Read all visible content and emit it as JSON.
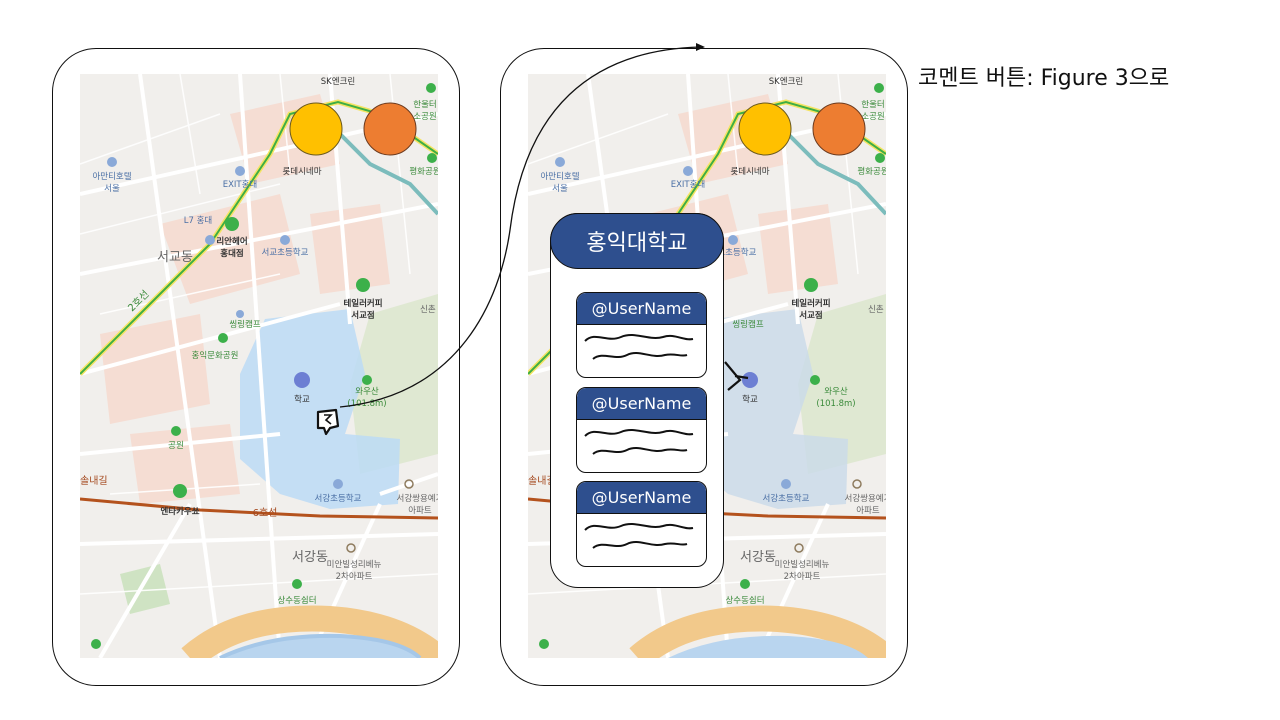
{
  "annotation": {
    "note": "코멘트 버튼: Figure 3으로"
  },
  "colors": {
    "yellow_button": "#FFC000",
    "orange_button": "#ED7D31",
    "popup_blue": "#2E4F8E"
  },
  "map": {
    "labels": {
      "sk": "SK엔크린",
      "amanti": "아만티호텔",
      "seoul": "서울",
      "exit": "EXIT홍대",
      "lotte": "롯데시네마",
      "l7": "L7 홍대",
      "lian1": "리안헤어",
      "lian2": "홍대점",
      "school": "서교초등학교",
      "seogyo": "서교동",
      "line2": "2호선",
      "tailor1": "테일러커피",
      "tailor2": "서교점",
      "ssiring": "씽링캠프",
      "hongik_park": "홍익문화공원",
      "campus": "학교",
      "wausan1": "와우산",
      "wausan2": "(101.8m)",
      "sinchon": "신촌",
      "park": "공원",
      "road": "솔내길",
      "entakarusu": "엔타카우쑈",
      "line6": "6호선",
      "seogang_school": "서강초등학교",
      "ssangyong1": "서강쌍용예가",
      "ssangyong2": "아파트",
      "seogangdong": "서강동",
      "miyan1": "미안빌성리베뉴",
      "miyan2": "2차아파트",
      "sangsu": "상수동쉼터",
      "hanultari": "한울터",
      "sogongwon": "소공원",
      "pyeonghwa": "평화공원"
    }
  },
  "popup": {
    "title": "홍익대학교",
    "comments": [
      {
        "user": "@UserName"
      },
      {
        "user": "@UserName"
      },
      {
        "user": "@UserName"
      }
    ]
  }
}
